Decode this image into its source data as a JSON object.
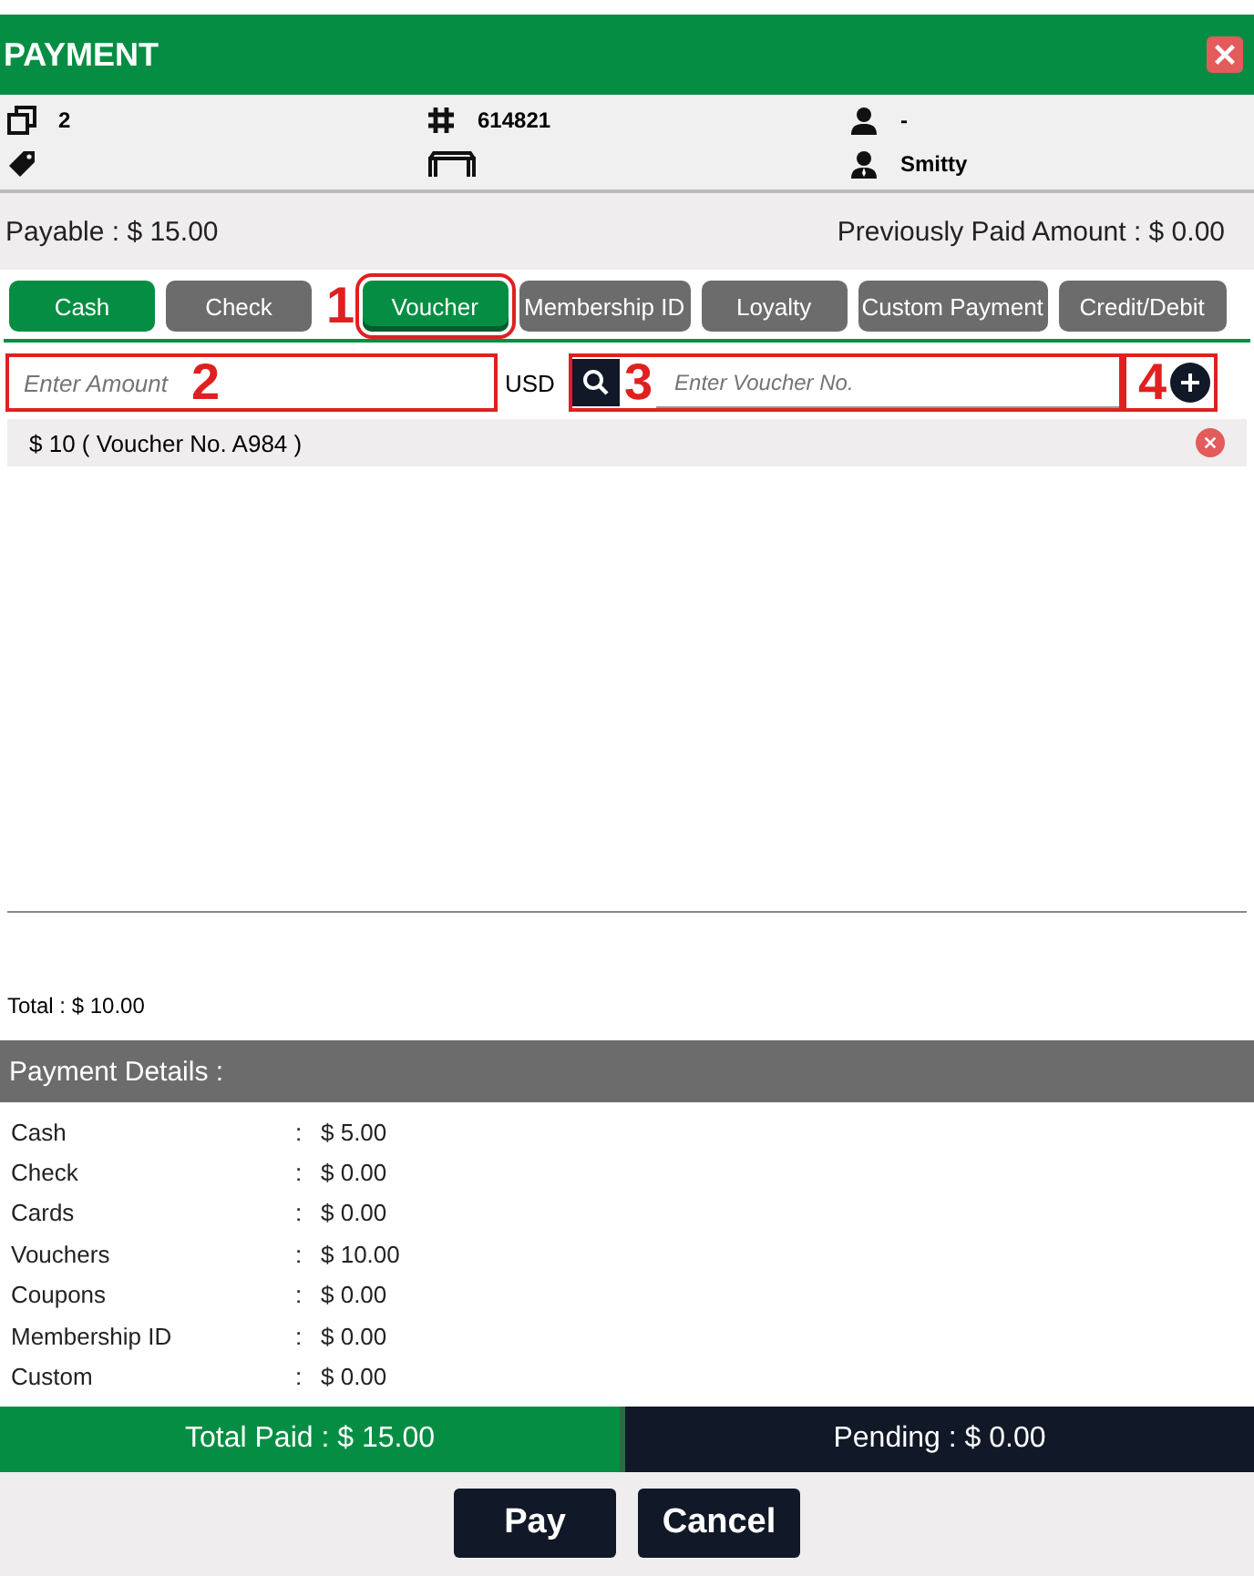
{
  "window": {
    "title": "PAYMENT"
  },
  "info": [
    {
      "kind": "copies",
      "value": "2"
    },
    {
      "kind": "number",
      "value": "614821"
    },
    {
      "kind": "customer",
      "value": "-"
    },
    {
      "kind": "tag"
    },
    {
      "kind": "table"
    },
    {
      "kind": "server",
      "value": "Smitty"
    }
  ],
  "payable": "Payable : $ 15.00",
  "previously_paid": "Previously Paid Amount : $ 0.00",
  "tabs": [
    {
      "label": "Cash",
      "selected": false,
      "highlighted": true
    },
    {
      "label": "Check",
      "selected": false,
      "highlighted": false
    },
    {
      "label": "Voucher",
      "selected": true,
      "highlighted": true,
      "callout": "1"
    },
    {
      "label": "Membership ID",
      "selected": false,
      "highlighted": false
    },
    {
      "label": "Loyalty",
      "selected": false,
      "highlighted": false
    },
    {
      "label": "Custom Payment",
      "selected": false,
      "highlighted": false
    },
    {
      "label": "Credit/Debit",
      "selected": false,
      "highlighted": false
    }
  ],
  "amount_field": {
    "placeholder": "Enter Amount",
    "callout": "2"
  },
  "currency": "USD",
  "voucher_field": {
    "placeholder": "Enter Voucher No.",
    "callout": "3"
  },
  "add_button": {
    "callout": "4"
  },
  "vouchers": [
    {
      "text": "$ 10 ( Voucher No.  A984 )"
    }
  ],
  "total": "Total : $  10.00",
  "payment_details": {
    "title": "Payment Details :",
    "rows": [
      {
        "label": "Cash",
        "separator": ":",
        "value": "$ 5.00"
      },
      {
        "label": "Check",
        "separator": ":",
        "value": "$ 0.00"
      },
      {
        "label": "Cards",
        "separator": ":",
        "value": "$ 0.00"
      },
      {
        "label": "Vouchers",
        "separator": ":",
        "value": "$ 10.00"
      },
      {
        "label": "Coupons",
        "separator": ":",
        "value": "$ 0.00"
      },
      {
        "label": "Membership ID",
        "separator": ":",
        "value": "$ 0.00"
      },
      {
        "label": "Custom",
        "separator": ":",
        "value": "$ 0.00"
      }
    ]
  },
  "total_paid": "Total Paid : $ 15.00",
  "pending": "Pending : $ 0.00",
  "buttons": [
    "Pay",
    "Cancel"
  ]
}
